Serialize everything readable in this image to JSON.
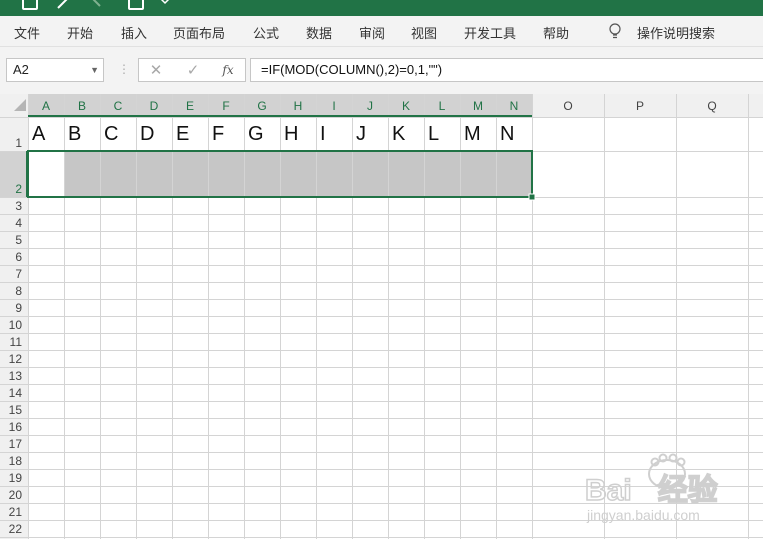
{
  "ribbon": {
    "tabs": [
      "文件",
      "开始",
      "插入",
      "页面布局",
      "公式",
      "数据",
      "审阅",
      "视图",
      "开发工具",
      "帮助"
    ],
    "tellme": "操作说明搜索"
  },
  "formula_bar": {
    "name_box": "A2",
    "cancel_icon": "✕",
    "enter_icon": "✓",
    "fx_label": "fx",
    "formula": "=IF(MOD(COLUMN(),2)=0,1,\"\")"
  },
  "grid": {
    "columns": [
      "A",
      "B",
      "C",
      "D",
      "E",
      "F",
      "G",
      "H",
      "I",
      "J",
      "K",
      "L",
      "M",
      "N",
      "O",
      "P",
      "Q"
    ],
    "rows": [
      "1",
      "2",
      "3",
      "4",
      "5",
      "6",
      "7",
      "8",
      "9",
      "10",
      "11",
      "12",
      "13",
      "14",
      "15",
      "16",
      "17",
      "18",
      "19",
      "20",
      "21",
      "22"
    ],
    "row1_values": [
      "A",
      "B",
      "C",
      "D",
      "E",
      "F",
      "G",
      "H",
      "I",
      "J",
      "K",
      "L",
      "M",
      "N"
    ],
    "selection": "A2:N2",
    "colors": {
      "header_bg": "#f0f0f0",
      "selected_header_bg": "#d2d2d2",
      "selected_header_text": "#217346",
      "gridline": "#d4d4d4",
      "selection_border": "#217346",
      "shaded_cell": "#c6c6c6"
    }
  },
  "watermark": {
    "brand": "Bai",
    "brand2": "经验",
    "url": "jingyan.baidu.com"
  }
}
